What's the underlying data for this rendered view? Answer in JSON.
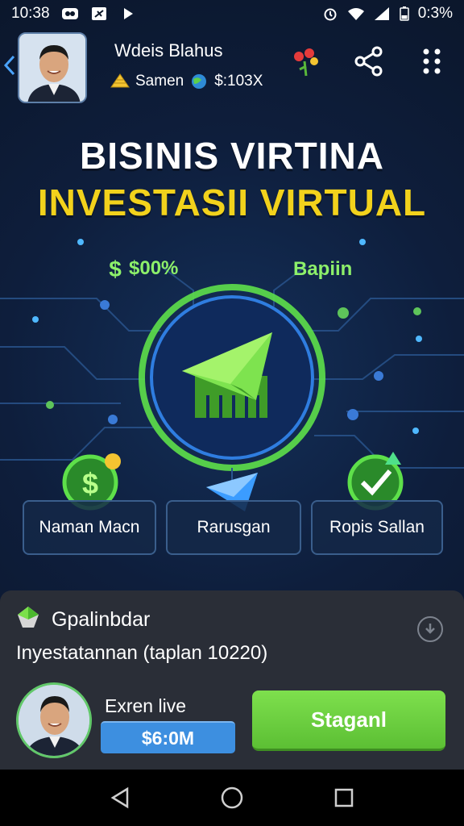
{
  "status_bar": {
    "time": "10:38",
    "battery": "0:3%",
    "icons": [
      "media-icon",
      "airplane-icon",
      "play-icon",
      "alarm-icon",
      "wifi-icon",
      "signal-icon",
      "battery-icon"
    ]
  },
  "header": {
    "user_name": "Wdeis Blahus",
    "level_label": "Samen",
    "balance": "$:103X",
    "icons": [
      "back-icon",
      "avatar",
      "gold-icon",
      "globe-icon",
      "gift-icon",
      "share-icon",
      "grid-menu-icon"
    ]
  },
  "hero": {
    "title_line1": "BISINIS VIRTINA",
    "title_line2": "INVESTASII VIRTUAL",
    "left_badge": "$00%",
    "left_badge_icon": "dollar-icon",
    "right_badge": "Bapiin",
    "center_icon": "paper-plane-icon"
  },
  "features": [
    {
      "label": "Naman Macn",
      "icon": "dollar-coin-icon"
    },
    {
      "label": "Rarusgan",
      "icon": "envelope-icon"
    },
    {
      "label": "Ropis Sallan",
      "icon": "check-badge-icon"
    }
  ],
  "panel": {
    "title": "Gpalinbdar",
    "subtitle": "Inyestatannan (taplan 10220)",
    "live_label": "Exren live",
    "price": "$6:0M",
    "cta": "Staganl"
  },
  "colors": {
    "accent_green": "#5cbf34",
    "title_yellow": "#f2d21c",
    "badge_blue": "#3d8fe0",
    "panel_bg": "#2a2e37"
  },
  "navbar": {
    "buttons": [
      "back-nav-icon",
      "home-nav-icon",
      "recents-nav-icon"
    ]
  }
}
